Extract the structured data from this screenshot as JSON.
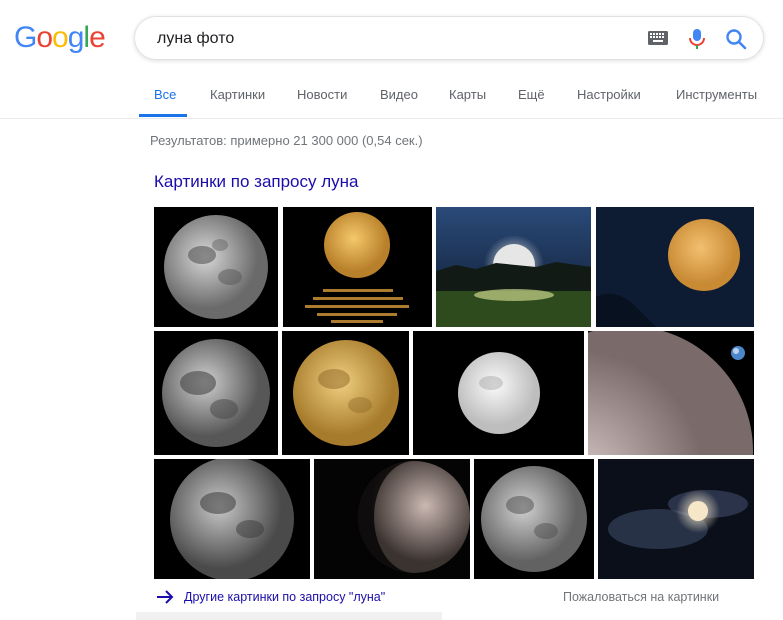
{
  "logo": {
    "letters": [
      "G",
      "o",
      "o",
      "g",
      "l",
      "e"
    ],
    "colors": [
      "#4285f4",
      "#ea4335",
      "#fbbc05",
      "#4285f4",
      "#34a853",
      "#ea4335"
    ]
  },
  "search": {
    "query": "луна фото"
  },
  "tabs": [
    {
      "label": "Все",
      "active": true
    },
    {
      "label": "Картинки"
    },
    {
      "label": "Новости"
    },
    {
      "label": "Видео"
    },
    {
      "label": "Карты"
    },
    {
      "label": "Ещё"
    },
    {
      "label": "Настройки"
    },
    {
      "label": "Инструменты"
    }
  ],
  "result_stats": "Результатов: примерно 21 300 000 (0,54 сек.)",
  "images_block": {
    "heading": "Картинки по запросу луна",
    "more_link": "Другие картинки по запросу \"луна\"",
    "report_link": "Пожаловаться на картинки"
  },
  "colors": {
    "accent": "#1a73e8",
    "link": "#1a0dab",
    "muted": "#70757a"
  }
}
